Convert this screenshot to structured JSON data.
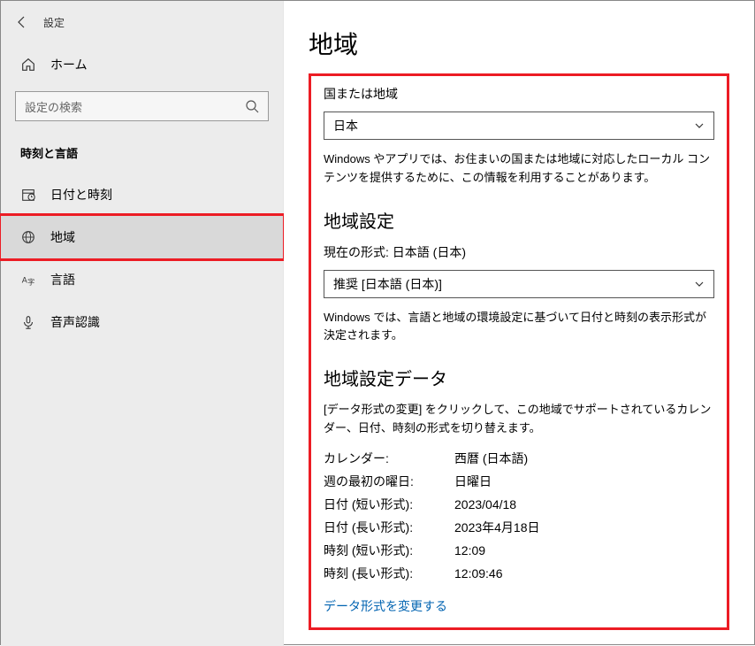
{
  "header": {
    "appTitle": "設定"
  },
  "sidebar": {
    "home_label": "ホーム",
    "search_placeholder": "設定の検索",
    "section_label": "時刻と言語",
    "items": [
      {
        "label": "日付と時刻"
      },
      {
        "label": "地域"
      },
      {
        "label": "言語"
      },
      {
        "label": "音声認識"
      }
    ]
  },
  "main": {
    "title": "地域",
    "country_heading": "国または地域",
    "country_value": "日本",
    "country_desc": "Windows やアプリでは、お住まいの国または地域に対応したローカル コンテンツを提供するために、この情報を利用することがあります。",
    "region_settings_heading": "地域設定",
    "current_format_label": "現在の形式: 日本語 (日本)",
    "format_dropdown_value": "推奨 [日本語 (日本)]",
    "format_desc": "Windows では、言語と地域の環境設定に基づいて日付と時刻の表示形式が決定されます。",
    "region_data_heading": "地域設定データ",
    "region_data_desc": "[データ形式の変更] をクリックして、この地域でサポートされているカレンダー、日付、時刻の形式を切り替えます。",
    "rows": [
      {
        "k": "カレンダー:",
        "v": "西暦 (日本語)"
      },
      {
        "k": "週の最初の曜日:",
        "v": "日曜日"
      },
      {
        "k": "日付 (短い形式):",
        "v": "2023/04/18"
      },
      {
        "k": "日付 (長い形式):",
        "v": "2023年4月18日"
      },
      {
        "k": "時刻 (短い形式):",
        "v": "12:09"
      },
      {
        "k": "時刻 (長い形式):",
        "v": "12:09:46"
      }
    ],
    "change_format_link": "データ形式を変更する"
  }
}
